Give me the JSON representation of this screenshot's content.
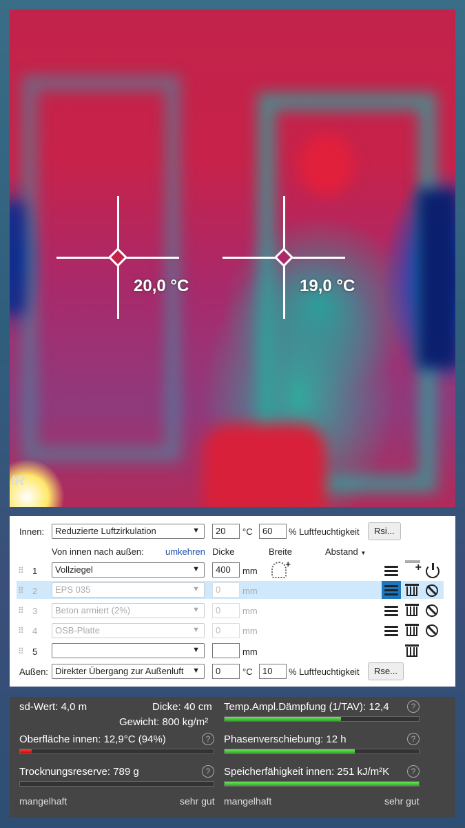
{
  "thermal": {
    "measurements": [
      {
        "label": "20,0 °C"
      },
      {
        "label": "19,0 °C"
      }
    ],
    "logo": "IR",
    "palette": [
      "#c2234a",
      "#8f3a7c",
      "#1fa8a0",
      "#0c2a86",
      "#ffe86a"
    ]
  },
  "panel": {
    "inside_label": "Innen:",
    "inside_condition": "Reduzierte Luftzirkulation",
    "inside_temp": "20",
    "temp_unit": "°C",
    "inside_humidity": "60",
    "humidity_label": "% Luftfeuchtigkeit",
    "rsi_button": "Rsi...",
    "direction_label": "Von innen nach außen:",
    "reverse_link": "umkehren",
    "col_thickness": "Dicke",
    "col_width": "Breite",
    "col_spacing": "Abstand",
    "unit_mm": "mm",
    "layers": [
      {
        "index": "1",
        "material": "Vollziegel",
        "thickness": "400",
        "enabled": true
      },
      {
        "index": "2",
        "material": "EPS 035",
        "thickness": "0",
        "enabled": false
      },
      {
        "index": "3",
        "material": "Beton armiert (2%)",
        "thickness": "0",
        "enabled": false
      },
      {
        "index": "4",
        "material": "OSB-Platte",
        "thickness": "0",
        "enabled": false
      },
      {
        "index": "5",
        "material": "",
        "thickness": "",
        "enabled": true
      }
    ],
    "outside_label": "Außen:",
    "outside_condition": "Direkter Übergang zur Außenluft",
    "outside_temp": "0",
    "outside_humidity": "10",
    "rse_button": "Rse..."
  },
  "dashboard": {
    "sd_value": "sd-Wert: 4,0 m",
    "thickness": "Dicke: 40 cm",
    "weight": "Gewicht: 800 kg/m²",
    "surface_inside": "Oberfläche innen: 12,9°C (94%)",
    "surface_inside_level": 0.06,
    "drying_reserve": "Trocknungsreserve: 789 g",
    "drying_reserve_level": 0.0,
    "temp_damping": "Temp.Ampl.Dämpfung (1/TAV): 12,4",
    "temp_damping_level": 0.6,
    "phase_shift": "Phasenverschiebung: 12 h",
    "phase_shift_level": 0.67,
    "heat_capacity": "Speicherfähigkeit innen: 251 kJ/m²K",
    "heat_capacity_level": 1.0,
    "scale_low": "mangelhaft",
    "scale_high": "sehr gut",
    "help_glyph": "?"
  }
}
